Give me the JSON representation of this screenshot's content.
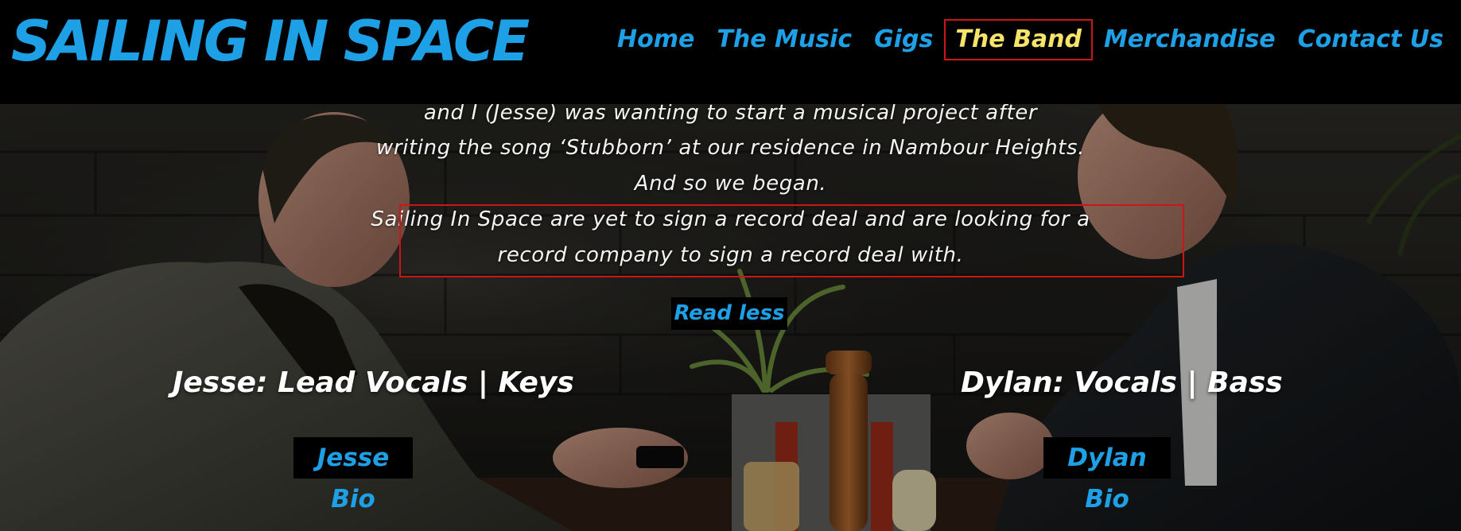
{
  "header": {
    "logo_text": "SAILING IN SPACE",
    "nav": [
      {
        "label": "Home"
      },
      {
        "label": "The Music"
      },
      {
        "label": "Gigs"
      },
      {
        "label": "The Band",
        "active": true
      },
      {
        "label": "Merchandise"
      },
      {
        "label": "Contact Us"
      }
    ]
  },
  "story": {
    "lines": [
      "and I (Jesse) was wanting to start a musical project after",
      "writing the song ‘Stubborn’ at our residence in Nambour Heights.",
      "And so we began.",
      "Sailing In Space are yet to sign a record deal and are looking for a",
      "record company to sign a record deal with."
    ]
  },
  "read_less_label": "Read less",
  "members": [
    {
      "title": "Jesse: Lead Vocals | Keys",
      "bio_label": "Jesse Bio"
    },
    {
      "title": "Dylan: Vocals | Bass",
      "bio_label": "Dylan Bio"
    }
  ],
  "colors": {
    "accent": "#1ea0e6",
    "active_nav": "#f5e36a",
    "highlight_border": "#cc1515",
    "header_bg": "#000000"
  }
}
